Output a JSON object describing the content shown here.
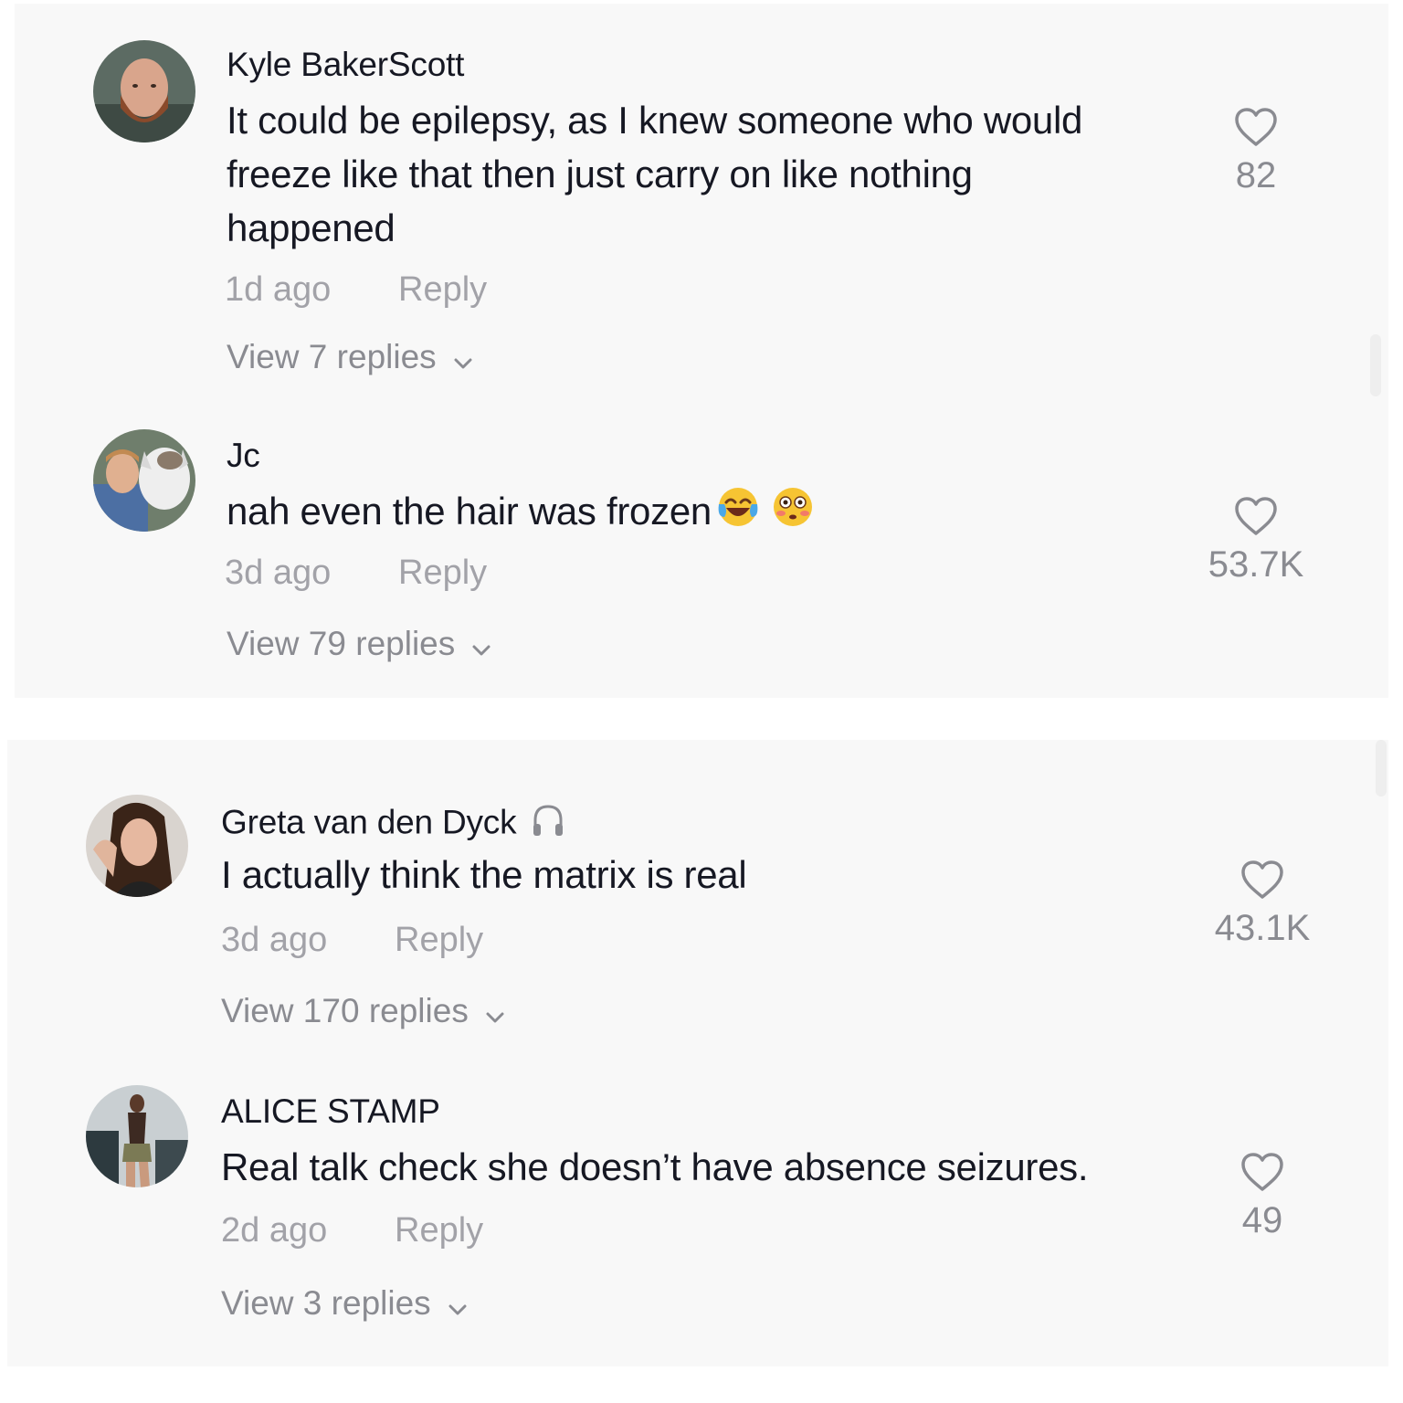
{
  "panels": [
    {
      "comments": [
        {
          "username": "Kyle BakerScott",
          "text_lines": [
            "It could be epilepsy, as I knew someone who would",
            "freeze like that then just carry on like nothing",
            "happened"
          ],
          "time": "1d ago",
          "reply_label": "Reply",
          "view_replies": "View 7 replies",
          "likes": "82"
        },
        {
          "username": "Jc",
          "text": "nah even the hair was frozen",
          "emojis": [
            "tears-of-joy-emoji",
            "flushed-face-emoji"
          ],
          "time": "3d ago",
          "reply_label": "Reply",
          "view_replies": "View 79 replies",
          "likes": "53.7K"
        }
      ]
    },
    {
      "comments": [
        {
          "username": "Greta van den Dyck",
          "badge_icon": "headphones-icon",
          "text": "I actually think the matrix is real",
          "time": "3d ago",
          "reply_label": "Reply",
          "view_replies": "View 170 replies",
          "likes": "43.1K"
        },
        {
          "username": "ALICE STAMP",
          "text": "Real talk check she doesn’t have absence seizures.",
          "time": "2d ago",
          "reply_label": "Reply",
          "view_replies": "View 3 replies",
          "likes": "49"
        }
      ]
    }
  ],
  "colors": {
    "panel_background": "#f8f8f8",
    "text_primary": "#161823",
    "text_secondary": "#a2a2a8",
    "icon_gray": "#8a8b91"
  }
}
